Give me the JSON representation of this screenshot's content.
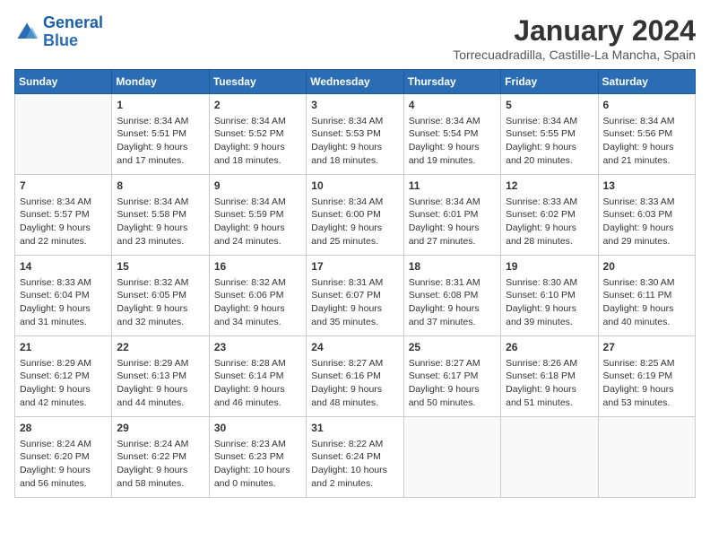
{
  "header": {
    "logo_line1": "General",
    "logo_line2": "Blue",
    "month": "January 2024",
    "location": "Torrecuadradilla, Castille-La Mancha, Spain"
  },
  "days_of_week": [
    "Sunday",
    "Monday",
    "Tuesday",
    "Wednesday",
    "Thursday",
    "Friday",
    "Saturday"
  ],
  "weeks": [
    [
      {
        "day": "",
        "data": ""
      },
      {
        "day": "1",
        "data": "Sunrise: 8:34 AM\nSunset: 5:51 PM\nDaylight: 9 hours\nand 17 minutes."
      },
      {
        "day": "2",
        "data": "Sunrise: 8:34 AM\nSunset: 5:52 PM\nDaylight: 9 hours\nand 18 minutes."
      },
      {
        "day": "3",
        "data": "Sunrise: 8:34 AM\nSunset: 5:53 PM\nDaylight: 9 hours\nand 18 minutes."
      },
      {
        "day": "4",
        "data": "Sunrise: 8:34 AM\nSunset: 5:54 PM\nDaylight: 9 hours\nand 19 minutes."
      },
      {
        "day": "5",
        "data": "Sunrise: 8:34 AM\nSunset: 5:55 PM\nDaylight: 9 hours\nand 20 minutes."
      },
      {
        "day": "6",
        "data": "Sunrise: 8:34 AM\nSunset: 5:56 PM\nDaylight: 9 hours\nand 21 minutes."
      }
    ],
    [
      {
        "day": "7",
        "data": "Sunrise: 8:34 AM\nSunset: 5:57 PM\nDaylight: 9 hours\nand 22 minutes."
      },
      {
        "day": "8",
        "data": "Sunrise: 8:34 AM\nSunset: 5:58 PM\nDaylight: 9 hours\nand 23 minutes."
      },
      {
        "day": "9",
        "data": "Sunrise: 8:34 AM\nSunset: 5:59 PM\nDaylight: 9 hours\nand 24 minutes."
      },
      {
        "day": "10",
        "data": "Sunrise: 8:34 AM\nSunset: 6:00 PM\nDaylight: 9 hours\nand 25 minutes."
      },
      {
        "day": "11",
        "data": "Sunrise: 8:34 AM\nSunset: 6:01 PM\nDaylight: 9 hours\nand 27 minutes."
      },
      {
        "day": "12",
        "data": "Sunrise: 8:33 AM\nSunset: 6:02 PM\nDaylight: 9 hours\nand 28 minutes."
      },
      {
        "day": "13",
        "data": "Sunrise: 8:33 AM\nSunset: 6:03 PM\nDaylight: 9 hours\nand 29 minutes."
      }
    ],
    [
      {
        "day": "14",
        "data": "Sunrise: 8:33 AM\nSunset: 6:04 PM\nDaylight: 9 hours\nand 31 minutes."
      },
      {
        "day": "15",
        "data": "Sunrise: 8:32 AM\nSunset: 6:05 PM\nDaylight: 9 hours\nand 32 minutes."
      },
      {
        "day": "16",
        "data": "Sunrise: 8:32 AM\nSunset: 6:06 PM\nDaylight: 9 hours\nand 34 minutes."
      },
      {
        "day": "17",
        "data": "Sunrise: 8:31 AM\nSunset: 6:07 PM\nDaylight: 9 hours\nand 35 minutes."
      },
      {
        "day": "18",
        "data": "Sunrise: 8:31 AM\nSunset: 6:08 PM\nDaylight: 9 hours\nand 37 minutes."
      },
      {
        "day": "19",
        "data": "Sunrise: 8:30 AM\nSunset: 6:10 PM\nDaylight: 9 hours\nand 39 minutes."
      },
      {
        "day": "20",
        "data": "Sunrise: 8:30 AM\nSunset: 6:11 PM\nDaylight: 9 hours\nand 40 minutes."
      }
    ],
    [
      {
        "day": "21",
        "data": "Sunrise: 8:29 AM\nSunset: 6:12 PM\nDaylight: 9 hours\nand 42 minutes."
      },
      {
        "day": "22",
        "data": "Sunrise: 8:29 AM\nSunset: 6:13 PM\nDaylight: 9 hours\nand 44 minutes."
      },
      {
        "day": "23",
        "data": "Sunrise: 8:28 AM\nSunset: 6:14 PM\nDaylight: 9 hours\nand 46 minutes."
      },
      {
        "day": "24",
        "data": "Sunrise: 8:27 AM\nSunset: 6:16 PM\nDaylight: 9 hours\nand 48 minutes."
      },
      {
        "day": "25",
        "data": "Sunrise: 8:27 AM\nSunset: 6:17 PM\nDaylight: 9 hours\nand 50 minutes."
      },
      {
        "day": "26",
        "data": "Sunrise: 8:26 AM\nSunset: 6:18 PM\nDaylight: 9 hours\nand 51 minutes."
      },
      {
        "day": "27",
        "data": "Sunrise: 8:25 AM\nSunset: 6:19 PM\nDaylight: 9 hours\nand 53 minutes."
      }
    ],
    [
      {
        "day": "28",
        "data": "Sunrise: 8:24 AM\nSunset: 6:20 PM\nDaylight: 9 hours\nand 56 minutes."
      },
      {
        "day": "29",
        "data": "Sunrise: 8:24 AM\nSunset: 6:22 PM\nDaylight: 9 hours\nand 58 minutes."
      },
      {
        "day": "30",
        "data": "Sunrise: 8:23 AM\nSunset: 6:23 PM\nDaylight: 10 hours\nand 0 minutes."
      },
      {
        "day": "31",
        "data": "Sunrise: 8:22 AM\nSunset: 6:24 PM\nDaylight: 10 hours\nand 2 minutes."
      },
      {
        "day": "",
        "data": ""
      },
      {
        "day": "",
        "data": ""
      },
      {
        "day": "",
        "data": ""
      }
    ]
  ]
}
